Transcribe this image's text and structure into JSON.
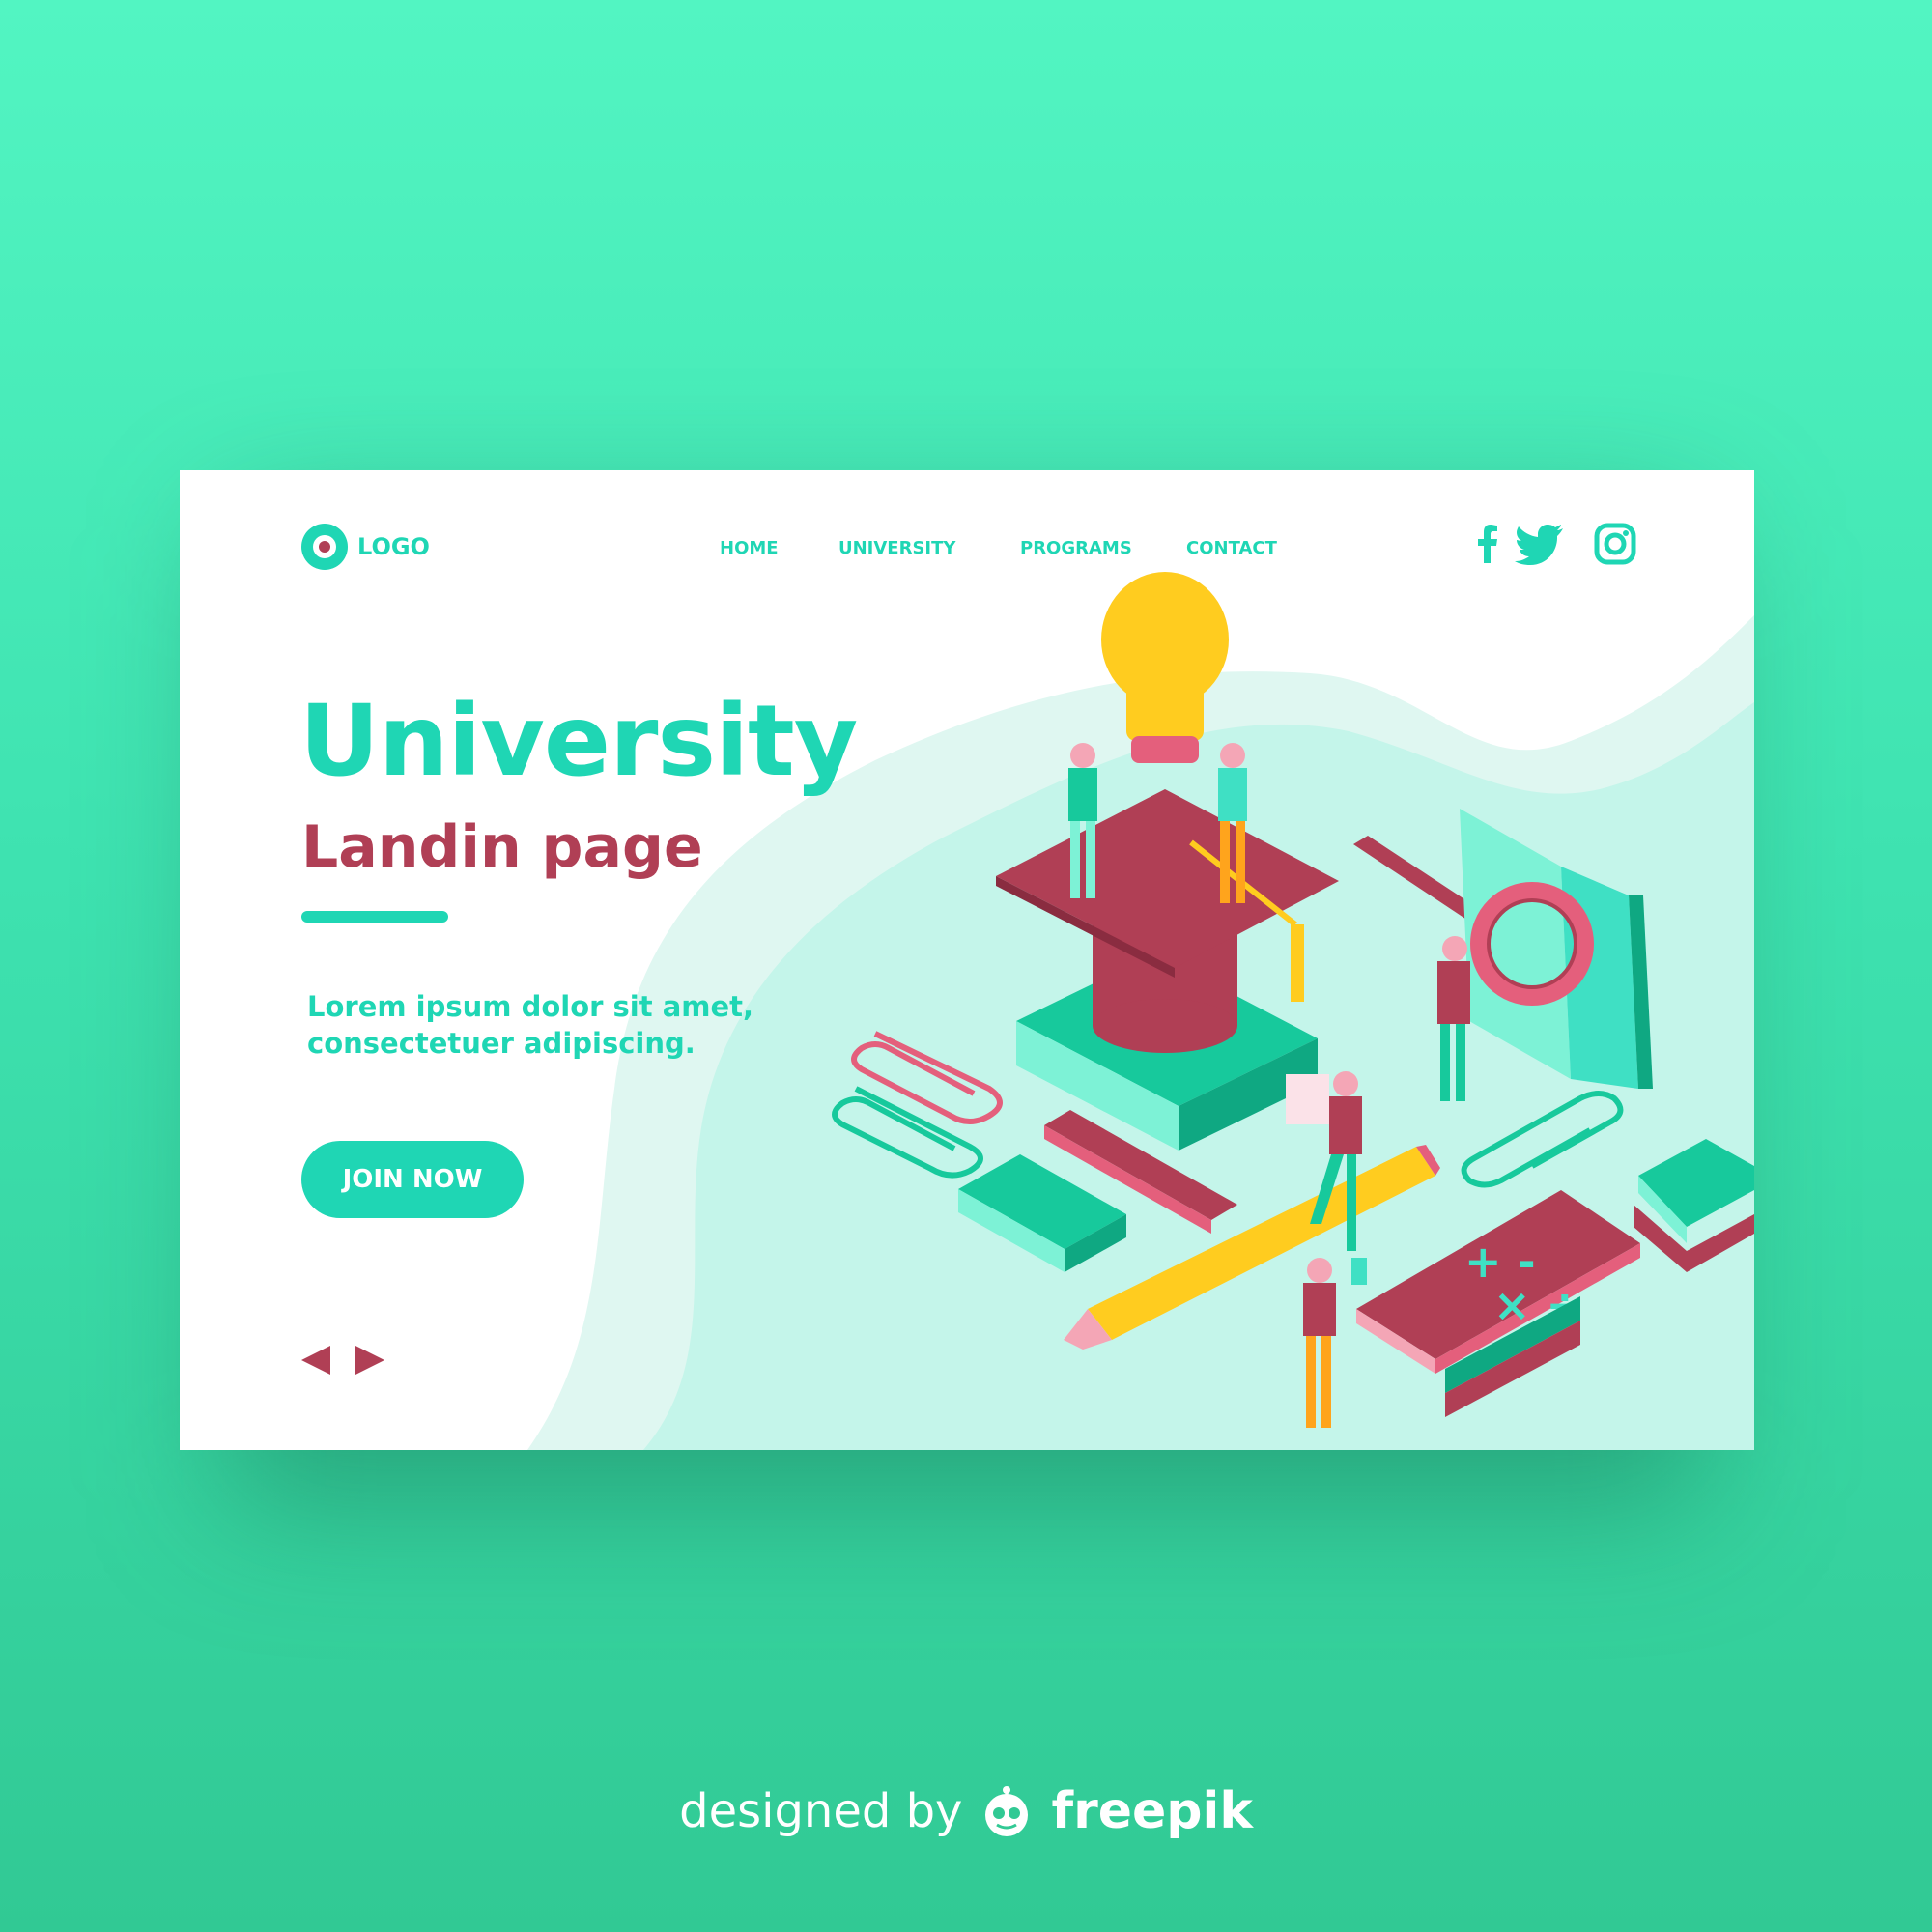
{
  "logo": {
    "text": "LOGO"
  },
  "nav": {
    "items": [
      {
        "label": "HOME"
      },
      {
        "label": "UNIVERSITY"
      },
      {
        "label": "PROGRAMS"
      },
      {
        "label": "CONTACT"
      }
    ]
  },
  "social": {
    "icons": [
      "facebook-icon",
      "twitter-icon",
      "instagram-icon"
    ]
  },
  "hero": {
    "title": "University",
    "subtitle": "Landin page",
    "text_line1": "Lorem ipsum dolor sit amet,",
    "text_line2": "consectetuer adipiscing.",
    "cta_label": "JOIN NOW"
  },
  "credit": {
    "prefix": "designed by",
    "brand": "freepik"
  },
  "colors": {
    "accent": "#1fd6b4",
    "brand_red": "#b03f55",
    "background_top": "#52f5c2",
    "background_bottom": "#31c994",
    "wave_light": "#dff7f1",
    "wave": "#c4f5ea"
  }
}
